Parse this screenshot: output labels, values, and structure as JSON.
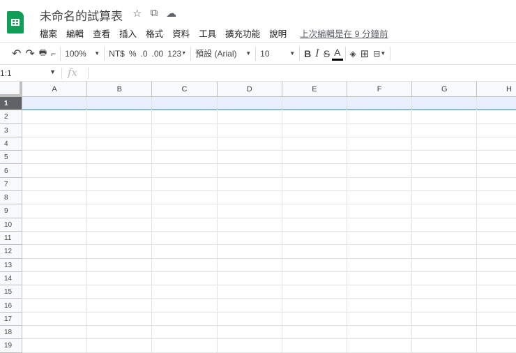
{
  "title": "未命名的試算表",
  "title_icons": [
    "star-icon",
    "move-to-folder-icon",
    "cloud-status-icon"
  ],
  "menu": [
    "檔案",
    "編輯",
    "查看",
    "插入",
    "格式",
    "資料",
    "工具",
    "擴充功能",
    "說明"
  ],
  "last_edit": "上次編輯是在 9 分鐘前",
  "toolbar": {
    "zoom": "100%",
    "currency": "NT$",
    "percent": "%",
    "dec_decrease": ".0",
    "dec_increase": ".00",
    "more_formats": "123",
    "font": "預設 (Arial)",
    "font_size": "10",
    "bold": "B",
    "italic": "I",
    "strike": "S",
    "text_color": "A"
  },
  "namebox": "1:1",
  "fx": "fx",
  "columns": [
    "A",
    "B",
    "C",
    "D",
    "E",
    "F",
    "G",
    "H"
  ],
  "rows": [
    "1",
    "2",
    "3",
    "4",
    "5",
    "6",
    "7",
    "8",
    "9",
    "10",
    "11",
    "12",
    "13",
    "14",
    "15",
    "16",
    "17",
    "18",
    "19"
  ],
  "selected_row": "1"
}
